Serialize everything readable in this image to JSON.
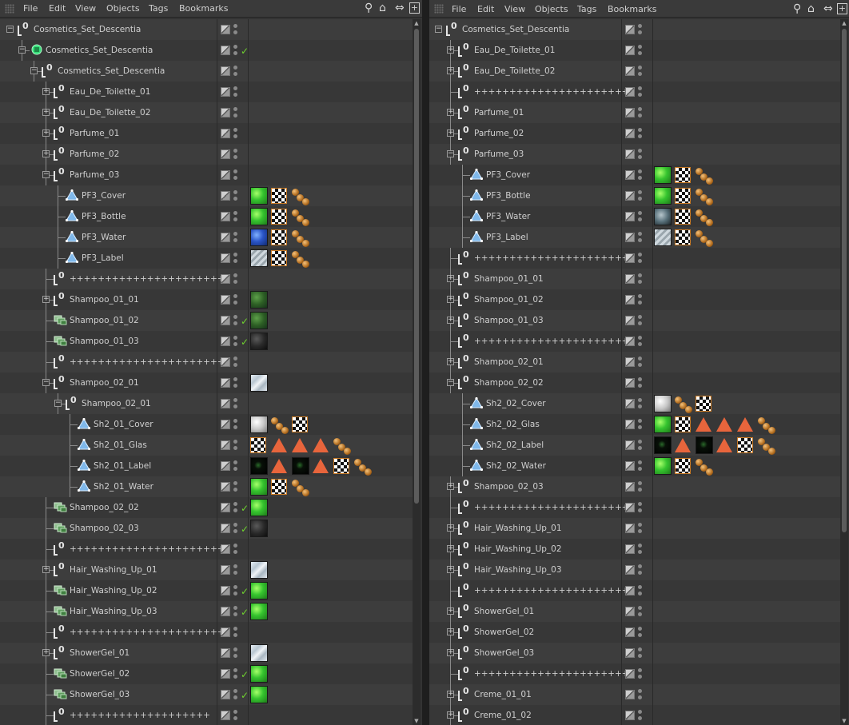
{
  "menus": [
    "File",
    "Edit",
    "View",
    "Objects",
    "Tags",
    "Bookmarks"
  ],
  "toolbar_icons": [
    "search-icon",
    "home-icon",
    "link-icon",
    "new-window-icon"
  ],
  "colors": {
    "background": "#333333",
    "row_alt": "#3d3d3d",
    "text": "#cfcfcf",
    "check": "#6fd12f",
    "tag_orange": "#e8653c"
  },
  "left_panel": {
    "rows": [
      {
        "label": "Cosmetics_Set_Descentia",
        "depth": 0,
        "icon": "null",
        "expander": "minus",
        "tags": []
      },
      {
        "label": "Cosmetics_Set_Descentia",
        "depth": 1,
        "icon": "instance-green",
        "expander": "minus",
        "check": true,
        "tags": []
      },
      {
        "label": "Cosmetics_Set_Descentia",
        "depth": 2,
        "icon": "null",
        "expander": "minus",
        "tags": []
      },
      {
        "label": "Eau_De_Toilette_01",
        "depth": 3,
        "icon": "null",
        "expander": "plus",
        "tags": []
      },
      {
        "label": "Eau_De_Toilette_02",
        "depth": 3,
        "icon": "null",
        "expander": "plus",
        "tags": []
      },
      {
        "label": "Parfume_01",
        "depth": 3,
        "icon": "null",
        "expander": "plus",
        "tags": []
      },
      {
        "label": "Parfume_02",
        "depth": 3,
        "icon": "null",
        "expander": "plus",
        "tags": []
      },
      {
        "label": "Parfume_03",
        "depth": 3,
        "icon": "null",
        "expander": "minus",
        "tags": []
      },
      {
        "label": "PF3_Cover",
        "depth": 4,
        "icon": "poly",
        "tags": [
          "green",
          "checker",
          "balls"
        ]
      },
      {
        "label": "PF3_Bottle",
        "depth": 4,
        "icon": "poly",
        "tags": [
          "green",
          "checker",
          "balls"
        ]
      },
      {
        "label": "PF3_Water",
        "depth": 4,
        "icon": "poly",
        "tags": [
          "blue",
          "checker",
          "balls"
        ]
      },
      {
        "label": "PF3_Label",
        "depth": 4,
        "icon": "poly",
        "tags": [
          "stripe",
          "checker",
          "balls"
        ]
      },
      {
        "label": "++++++++++++++++++++++",
        "depth": 3,
        "icon": "null",
        "tags": []
      },
      {
        "label": "Shampoo_01_01",
        "depth": 3,
        "icon": "null",
        "expander": "plus",
        "tags": [
          "darkgreen"
        ]
      },
      {
        "label": "Shampoo_01_02",
        "depth": 3,
        "icon": "instance",
        "check": true,
        "tags": [
          "darkgreen"
        ]
      },
      {
        "label": "Shampoo_01_03",
        "depth": 3,
        "icon": "instance",
        "check": true,
        "tags": [
          "black"
        ]
      },
      {
        "label": "++++++++++++++++++++++",
        "depth": 3,
        "icon": "null",
        "tags": []
      },
      {
        "label": "Shampoo_02_01",
        "depth": 3,
        "icon": "null",
        "expander": "minus",
        "tags": [
          "glass"
        ]
      },
      {
        "label": "Shampoo_02_01",
        "depth": 4,
        "icon": "null",
        "expander": "minus",
        "tags": []
      },
      {
        "label": "Sh2_01_Cover",
        "depth": 5,
        "icon": "poly",
        "tags": [
          "white",
          "balls",
          "checker"
        ]
      },
      {
        "label": "Sh2_01_Glas",
        "depth": 5,
        "icon": "poly",
        "tags": [
          "checker",
          "tri",
          "tri",
          "tri",
          "balls"
        ]
      },
      {
        "label": "Sh2_01_Label",
        "depth": 5,
        "icon": "poly",
        "tags": [
          "space",
          "tri",
          "space",
          "tri",
          "checker",
          "balls"
        ]
      },
      {
        "label": "Sh2_01_Water",
        "depth": 5,
        "icon": "poly",
        "tags": [
          "green",
          "checker",
          "balls"
        ]
      },
      {
        "label": "Shampoo_02_02",
        "depth": 3,
        "icon": "instance",
        "check": true,
        "tags": [
          "green"
        ]
      },
      {
        "label": "Shampoo_02_03",
        "depth": 3,
        "icon": "instance",
        "check": true,
        "tags": [
          "black"
        ]
      },
      {
        "label": "++++++++++++++++++++++",
        "depth": 3,
        "icon": "null",
        "tags": []
      },
      {
        "label": "Hair_Washing_Up_01",
        "depth": 3,
        "icon": "null",
        "expander": "plus",
        "tags": [
          "glass"
        ]
      },
      {
        "label": "Hair_Washing_Up_02",
        "depth": 3,
        "icon": "instance",
        "check": true,
        "tags": [
          "green"
        ]
      },
      {
        "label": "Hair_Washing_Up_03",
        "depth": 3,
        "icon": "instance",
        "check": true,
        "tags": [
          "green"
        ]
      },
      {
        "label": "++++++++++++++++++++++",
        "depth": 3,
        "icon": "null",
        "tags": []
      },
      {
        "label": "ShowerGel_01",
        "depth": 3,
        "icon": "null",
        "expander": "plus",
        "tags": [
          "glass"
        ]
      },
      {
        "label": "ShowerGel_02",
        "depth": 3,
        "icon": "instance",
        "check": true,
        "tags": [
          "green"
        ]
      },
      {
        "label": "ShowerGel_03",
        "depth": 3,
        "icon": "instance",
        "check": true,
        "tags": [
          "green"
        ]
      },
      {
        "label": "++++++++++++++++++++",
        "depth": 3,
        "icon": "null",
        "tags": []
      }
    ]
  },
  "right_panel": {
    "rows": [
      {
        "label": "Cosmetics_Set_Descentia",
        "depth": 0,
        "icon": "null",
        "expander": "minus",
        "tags": []
      },
      {
        "label": "Eau_De_Toilette_01",
        "depth": 1,
        "icon": "null",
        "expander": "plus",
        "tags": []
      },
      {
        "label": "Eau_De_Toilette_02",
        "depth": 1,
        "icon": "null",
        "expander": "plus",
        "tags": []
      },
      {
        "label": "++++++++++++++++++++++",
        "depth": 1,
        "icon": "null",
        "tags": []
      },
      {
        "label": "Parfume_01",
        "depth": 1,
        "icon": "null",
        "expander": "plus",
        "tags": []
      },
      {
        "label": "Parfume_02",
        "depth": 1,
        "icon": "null",
        "expander": "plus",
        "tags": []
      },
      {
        "label": "Parfume_03",
        "depth": 1,
        "icon": "null",
        "expander": "minus",
        "tags": []
      },
      {
        "label": "PF3_Cover",
        "depth": 2,
        "icon": "poly",
        "tags": [
          "green",
          "checker",
          "balls"
        ]
      },
      {
        "label": "PF3_Bottle",
        "depth": 2,
        "icon": "poly",
        "tags": [
          "green",
          "checker",
          "balls"
        ]
      },
      {
        "label": "PF3_Water",
        "depth": 2,
        "icon": "poly",
        "tags": [
          "metal",
          "checker",
          "balls"
        ]
      },
      {
        "label": "PF3_Label",
        "depth": 2,
        "icon": "poly",
        "tags": [
          "stripe",
          "checker",
          "balls"
        ]
      },
      {
        "label": "++++++++++++++++++++++",
        "depth": 1,
        "icon": "null",
        "tags": []
      },
      {
        "label": "Shampoo_01_01",
        "depth": 1,
        "icon": "null",
        "expander": "plus",
        "tags": []
      },
      {
        "label": "Shampoo_01_02",
        "depth": 1,
        "icon": "null",
        "expander": "plus",
        "tags": []
      },
      {
        "label": "Shampoo_01_03",
        "depth": 1,
        "icon": "null",
        "expander": "plus",
        "tags": []
      },
      {
        "label": "++++++++++++++++++++++",
        "depth": 1,
        "icon": "null",
        "tags": []
      },
      {
        "label": "Shampoo_02_01",
        "depth": 1,
        "icon": "null",
        "expander": "plus",
        "tags": []
      },
      {
        "label": "Shampoo_02_02",
        "depth": 1,
        "icon": "null",
        "expander": "minus",
        "tags": []
      },
      {
        "label": "Sh2_02_Cover",
        "depth": 2,
        "icon": "poly",
        "tags": [
          "white",
          "balls",
          "checker"
        ]
      },
      {
        "label": "Sh2_02_Glas",
        "depth": 2,
        "icon": "poly",
        "tags": [
          "green",
          "checker",
          "tri",
          "tri",
          "tri",
          "balls"
        ]
      },
      {
        "label": "Sh2_02_Label",
        "depth": 2,
        "icon": "poly",
        "tags": [
          "space",
          "tri",
          "space",
          "tri",
          "checker",
          "balls"
        ]
      },
      {
        "label": "Sh2_02_Water",
        "depth": 2,
        "icon": "poly",
        "tags": [
          "green",
          "checker",
          "balls"
        ]
      },
      {
        "label": "Shampoo_02_03",
        "depth": 1,
        "icon": "null",
        "expander": "plus",
        "tags": []
      },
      {
        "label": "++++++++++++++++++++++",
        "depth": 1,
        "icon": "null",
        "tags": []
      },
      {
        "label": "Hair_Washing_Up_01",
        "depth": 1,
        "icon": "null",
        "expander": "plus",
        "tags": []
      },
      {
        "label": "Hair_Washing_Up_02",
        "depth": 1,
        "icon": "null",
        "expander": "plus",
        "tags": []
      },
      {
        "label": "Hair_Washing_Up_03",
        "depth": 1,
        "icon": "null",
        "expander": "plus",
        "tags": []
      },
      {
        "label": "++++++++++++++++++++++",
        "depth": 1,
        "icon": "null",
        "tags": []
      },
      {
        "label": "ShowerGel_01",
        "depth": 1,
        "icon": "null",
        "expander": "plus",
        "tags": []
      },
      {
        "label": "ShowerGel_02",
        "depth": 1,
        "icon": "null",
        "expander": "plus",
        "tags": []
      },
      {
        "label": "ShowerGel_03",
        "depth": 1,
        "icon": "null",
        "expander": "plus",
        "tags": []
      },
      {
        "label": "++++++++++++++++++++++",
        "depth": 1,
        "icon": "null",
        "tags": []
      },
      {
        "label": "Creme_01_01",
        "depth": 1,
        "icon": "null",
        "expander": "plus",
        "tags": []
      },
      {
        "label": "Creme_01_02",
        "depth": 1,
        "icon": "null",
        "expander": "plus",
        "tags": []
      }
    ]
  }
}
